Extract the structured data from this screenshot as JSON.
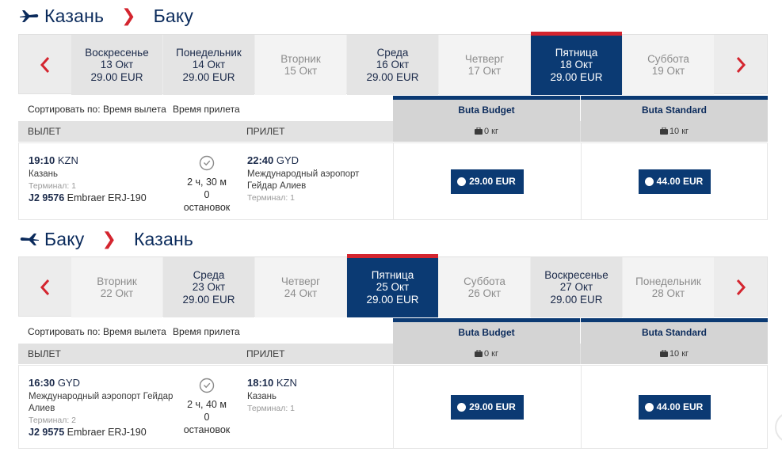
{
  "colors": {
    "brand_navy": "#0b3a73",
    "accent_red": "#d4252f",
    "unavailable_bg": "#f3f3f3",
    "available_bg": "#e4e4e4"
  },
  "segments": [
    {
      "from": "Казань",
      "to": "Баку",
      "plane_icon": "plane-takeoff-icon",
      "days": [
        {
          "day": "Воскресенье",
          "date": "13 Окт",
          "price": "29.00 EUR",
          "state": "avail"
        },
        {
          "day": "Понедельник",
          "date": "14 Окт",
          "price": "29.00 EUR",
          "state": "avail"
        },
        {
          "day": "Вторник",
          "date": "15 Окт",
          "price": "",
          "state": "na"
        },
        {
          "day": "Среда",
          "date": "16 Окт",
          "price": "29.00 EUR",
          "state": "avail"
        },
        {
          "day": "Четверг",
          "date": "17 Окт",
          "price": "",
          "state": "na"
        },
        {
          "day": "Пятница",
          "date": "18 Окт",
          "price": "29.00 EUR",
          "state": "sel"
        },
        {
          "day": "Суббота",
          "date": "19 Окт",
          "price": "",
          "state": "na"
        }
      ],
      "sort_label": "Сортировать по:",
      "sort_options": [
        "Время вылета",
        "Время прилета"
      ],
      "fares": [
        {
          "name": "Buta Budget",
          "baggage": "0 кг",
          "price": "29.00 EUR"
        },
        {
          "name": "Buta Standard",
          "baggage": "10 кг",
          "price": "44.00 EUR"
        }
      ],
      "col_departure": "ВЫЛЕТ",
      "col_arrival": "ПРИЛЕТ",
      "flight": {
        "dep_time": "19:10",
        "dep_code": "KZN",
        "dep_airport": "Казань",
        "dep_terminal": "Терминал: 1",
        "flight_no": "J2 9576",
        "aircraft": "Embraer ERJ-190",
        "duration": "2 ч, 30 м",
        "stops_count": "0",
        "stops_label": "остановок",
        "arr_time": "22:40",
        "arr_code": "GYD",
        "arr_airport": "Международный аэропорт Гейдар Алиев",
        "arr_terminal": "Терминал: 1"
      }
    },
    {
      "from": "Баку",
      "to": "Казань",
      "plane_icon": "plane-landing-icon",
      "days": [
        {
          "day": "Вторник",
          "date": "22 Окт",
          "price": "",
          "state": "na"
        },
        {
          "day": "Среда",
          "date": "23 Окт",
          "price": "29.00 EUR",
          "state": "avail"
        },
        {
          "day": "Четверг",
          "date": "24 Окт",
          "price": "",
          "state": "na"
        },
        {
          "day": "Пятница",
          "date": "25 Окт",
          "price": "29.00 EUR",
          "state": "sel"
        },
        {
          "day": "Суббота",
          "date": "26 Окт",
          "price": "",
          "state": "na"
        },
        {
          "day": "Воскресенье",
          "date": "27 Окт",
          "price": "29.00 EUR",
          "state": "avail"
        },
        {
          "day": "Понедельник",
          "date": "28 Окт",
          "price": "",
          "state": "na"
        }
      ],
      "sort_label": "Сортировать по:",
      "sort_options": [
        "Время вылета",
        "Время прилета"
      ],
      "fares": [
        {
          "name": "Buta Budget",
          "baggage": "0 кг",
          "price": "29.00 EUR"
        },
        {
          "name": "Buta Standard",
          "baggage": "10 кг",
          "price": "44.00 EUR"
        }
      ],
      "col_departure": "ВЫЛЕТ",
      "col_arrival": "ПРИЛЕТ",
      "flight": {
        "dep_time": "16:30",
        "dep_code": "GYD",
        "dep_airport": "Международный аэропорт Гейдар Алиев",
        "dep_terminal": "Терминал: 2",
        "flight_no": "J2 9575",
        "aircraft": "Embraer ERJ-190",
        "duration": "2 ч, 40 м",
        "stops_count": "0",
        "stops_label": "остановок",
        "arr_time": "18:10",
        "arr_code": "KZN",
        "arr_airport": "Казань",
        "arr_terminal": "Терминал: 1"
      }
    }
  ]
}
